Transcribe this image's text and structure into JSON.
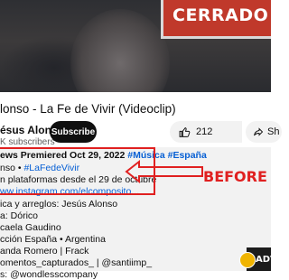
{
  "player": {
    "sign_text": "CERRADO"
  },
  "video": {
    "title": "lonso - La Fe de Vivir (Videoclip)"
  },
  "channel": {
    "name": "ésus Alonso",
    "subscribers": "K subscribers",
    "subscribe_label": "Subscribe"
  },
  "actions": {
    "like_count": "212",
    "share_label": "Sh"
  },
  "description": {
    "views_premiered": "ews  Premiered Oct 29, 2022",
    "tags_top": "#Música #España",
    "line2_prefix": "nso • ",
    "line2_tag": "#LaFedeVivir",
    "line3": "n plataformas desde el 29 de octubre",
    "link": "ww.instagram.com/elcomposito...",
    "credits": [
      "ica y arreglos: Jesús Alonso",
      "a: Dórico",
      "caela Gaudino",
      "cción España • Argentina",
      "anda Romero | Frack",
      "omentos_capturados_ | @santiimp_",
      "s: @wondlesscompany"
    ]
  },
  "annotation": {
    "label": "BEFORE",
    "color": "#e02020"
  },
  "watermark": {
    "text": "ADVI"
  }
}
